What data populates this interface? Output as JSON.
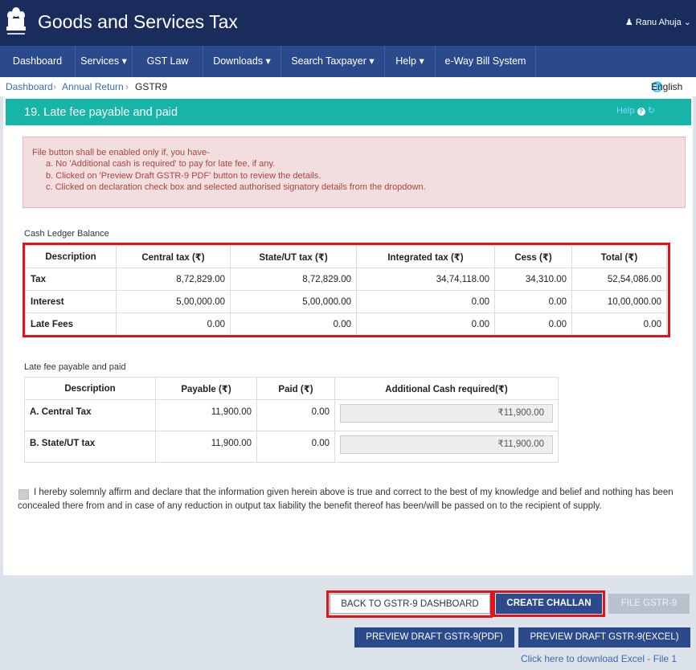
{
  "header": {
    "title": "Goods and Services Tax",
    "emblem_caption": "सत्यमेव जयते",
    "user": "Ranu Ahuja"
  },
  "nav": [
    "Dashboard",
    "Services",
    "GST Law",
    "Downloads",
    "Search Taxpayer",
    "Help",
    "e-Way Bill System"
  ],
  "breadcrumb": {
    "items": [
      "Dashboard",
      "Annual Return",
      "GSTR9"
    ],
    "language": "English"
  },
  "section": {
    "title": "19. Late fee payable and paid",
    "help": "Help"
  },
  "alert": {
    "intro": "File button shall be enabled only if, you have-",
    "items": [
      "a. No 'Additional cash is required' to pay for late fee, if any.",
      "b. Clicked on 'Preview Draft GSTR-9 PDF' button to review the details.",
      "c. Clicked on declaration check box and selected authorised signatory details from the dropdown."
    ]
  },
  "cash_ledger": {
    "label": "Cash Ledger Balance",
    "headers": [
      "Description",
      "Central tax (₹)",
      "State/UT tax (₹)",
      "Integrated tax (₹)",
      "Cess (₹)",
      "Total (₹)"
    ],
    "rows": [
      [
        "Tax",
        "8,72,829.00",
        "8,72,829.00",
        "34,74,118.00",
        "34,310.00",
        "52,54,086.00"
      ],
      [
        "Interest",
        "5,00,000.00",
        "5,00,000.00",
        "0.00",
        "0.00",
        "10,00,000.00"
      ],
      [
        "Late Fees",
        "0.00",
        "0.00",
        "0.00",
        "0.00",
        "0.00"
      ]
    ]
  },
  "late_fee": {
    "label": "Late fee payable and paid",
    "headers": [
      "Description",
      "Payable (₹)",
      "Paid (₹)",
      "Additional Cash required(₹)"
    ],
    "rows": [
      [
        "A. Central Tax",
        "11,900.00",
        "0.00",
        "₹11,900.00"
      ],
      [
        "B. State/UT tax",
        "11,900.00",
        "0.00",
        "₹11,900.00"
      ]
    ]
  },
  "declaration": "I hereby solemnly affirm and declare that the information given herein above is true and correct to the best of my knowledge and belief and nothing has been concealed there from and in case of any reduction in output tax liability the benefit thereof has been/will be passed on to the recipient of supply.",
  "buttons": {
    "back": "BACK TO GSTR-9 DASHBOARD",
    "challan": "CREATE CHALLAN",
    "file": "FILE GSTR-9",
    "preview_pdf": "PREVIEW DRAFT GSTR-9(PDF)",
    "preview_excel": "PREVIEW DRAFT GSTR-9(EXCEL)",
    "download_link": "Click here to download Excel - File 1"
  },
  "colors": {
    "header": "#1a2c5c",
    "nav": "#2b4a8b",
    "section": "#17b5a8",
    "highlight": "#e3131b"
  }
}
